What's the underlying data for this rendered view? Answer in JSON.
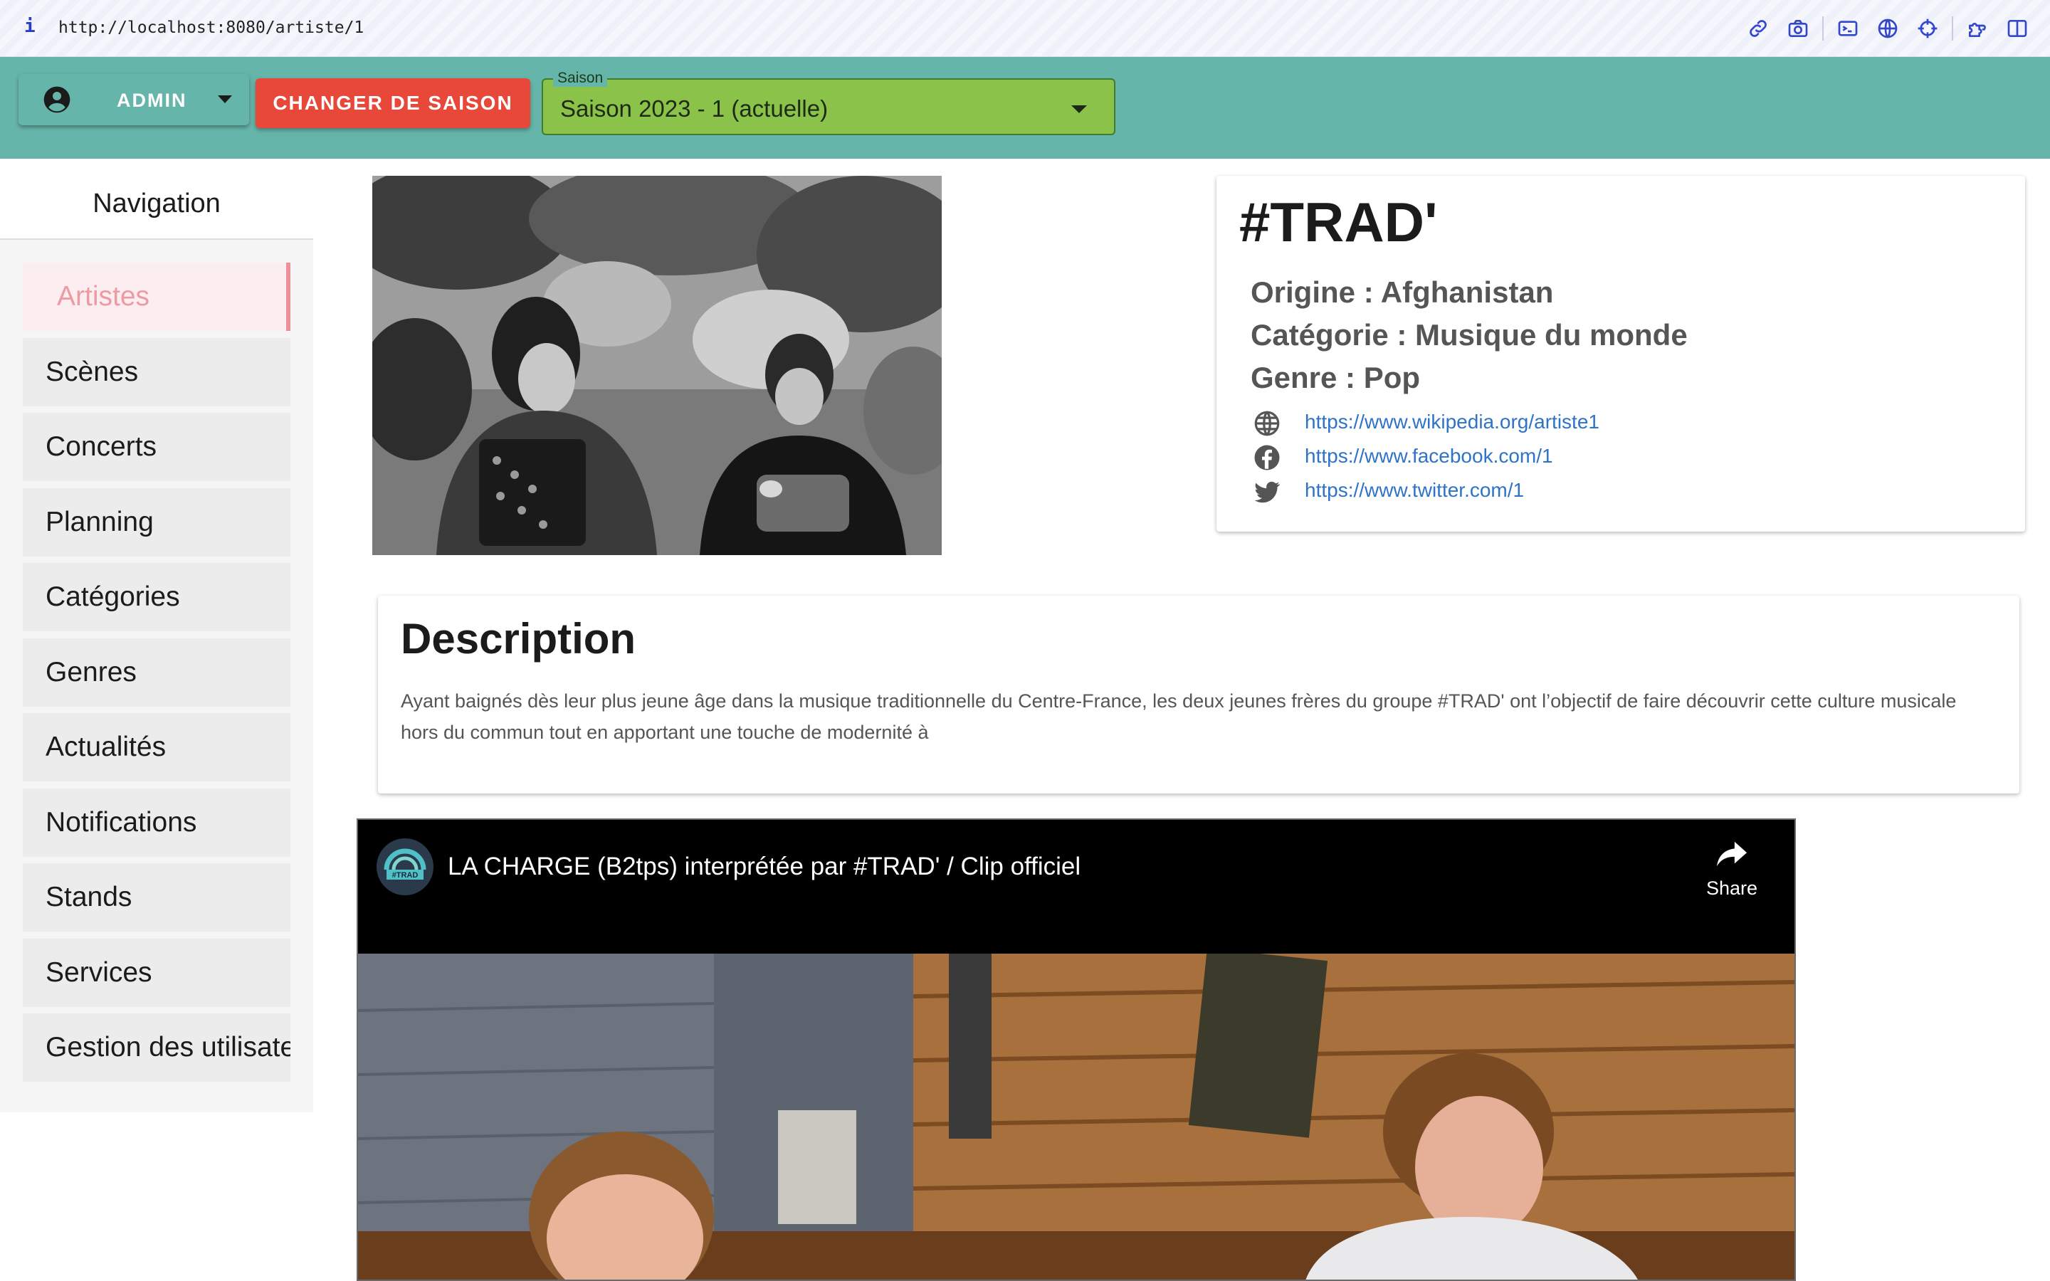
{
  "browser": {
    "info_glyph": "i",
    "url": "http://localhost:8080/artiste/1",
    "tools": [
      "link-icon",
      "camera-icon",
      "terminal-icon",
      "globe-icon",
      "crosshair-icon",
      "extensions-icon",
      "sidebar-icon"
    ]
  },
  "header": {
    "user_label": "ADMIN",
    "change_season_label": "CHANGER DE SAISON",
    "season_select": {
      "legend": "Saison",
      "value": "Saison 2023 - 1 (actuelle)"
    },
    "colors": {
      "bar": "#66b5aa",
      "season_button": "#e8483a",
      "season_select": "#8bc24a"
    }
  },
  "sidebar": {
    "title": "Navigation",
    "items": [
      {
        "label": "Artistes",
        "active": true
      },
      {
        "label": "Scènes"
      },
      {
        "label": "Concerts"
      },
      {
        "label": "Planning"
      },
      {
        "label": "Catégories"
      },
      {
        "label": "Genres"
      },
      {
        "label": "Actualités"
      },
      {
        "label": "Notifications"
      },
      {
        "label": "Stands"
      },
      {
        "label": "Services"
      },
      {
        "label": "Gestion des utilisateurs"
      }
    ]
  },
  "artist": {
    "name": "#TRAD'",
    "origin": "Origine : Afghanistan",
    "category": "Catégorie : Musique du monde",
    "genre": "Genre : Pop",
    "links": [
      {
        "icon": "globe-icon",
        "url": "https://www.wikipedia.org/artiste1"
      },
      {
        "icon": "facebook-icon",
        "url": "https://www.facebook.com/1"
      },
      {
        "icon": "twitter-icon",
        "url": "https://www.twitter.com/1"
      }
    ]
  },
  "description": {
    "title": "Description",
    "text": "Ayant baignés dès leur plus jeune âge dans la musique traditionnelle du Centre-France, les deux jeunes frères du groupe #TRAD' ont l’objectif de faire découvrir cette culture musicale hors du commun tout en apportant une touche de modernité à"
  },
  "video": {
    "title": "LA CHARGE (B2tps) interprétée par #TRAD' / Clip officiel",
    "share_label": "Share",
    "channel_logo_text": "#TRAD"
  }
}
